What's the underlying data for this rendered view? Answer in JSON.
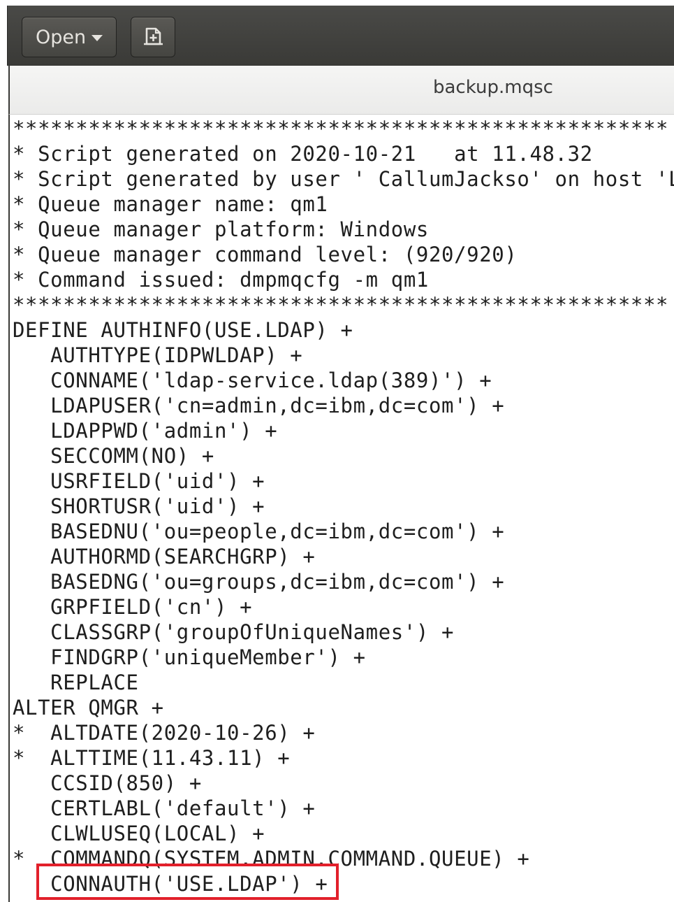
{
  "headerbar": {
    "open_label": "Open",
    "open_icon": "chevron-down-icon",
    "new_document_icon": "new-document-icon"
  },
  "tab": {
    "title": "backup.mqsc"
  },
  "editor": {
    "lines": [
      "****************************************************",
      "* Script generated on 2020-10-21   at 11.48.32",
      "* Script generated by user ' CallumJackso' on host 'L",
      "* Queue manager name: qm1",
      "* Queue manager platform: Windows",
      "* Queue manager command level: (920/920)",
      "* Command issued: dmpmqcfg -m qm1",
      "****************************************************",
      "DEFINE AUTHINFO(USE.LDAP) +",
      "   AUTHTYPE(IDPWLDAP) +",
      "   CONNAME('ldap-service.ldap(389)') +",
      "   LDAPUSER('cn=admin,dc=ibm,dc=com') +",
      "   LDAPPWD('admin') +",
      "   SECCOMM(NO) +",
      "   USRFIELD('uid') +",
      "   SHORTUSR('uid') +",
      "   BASEDNU('ou=people,dc=ibm,dc=com') +",
      "   AUTHORMD(SEARCHGRP) +",
      "   BASEDNG('ou=groups,dc=ibm,dc=com') +",
      "   GRPFIELD('cn') +",
      "   CLASSGRP('groupOfUniqueNames') +",
      "   FINDGRP('uniqueMember') +",
      "   REPLACE",
      "ALTER QMGR +",
      "*  ALTDATE(2020-10-26) +",
      "*  ALTTIME(11.43.11) +",
      "   CCSID(850) +",
      "   CERTLABL('default') +",
      "   CLWLUSEQ(LOCAL) +",
      "*  COMMANDQ(SYSTEM.ADMIN.COMMAND.QUEUE) +",
      "   CONNAUTH('USE.LDAP') +"
    ],
    "highlight_color": "#e2202b"
  }
}
